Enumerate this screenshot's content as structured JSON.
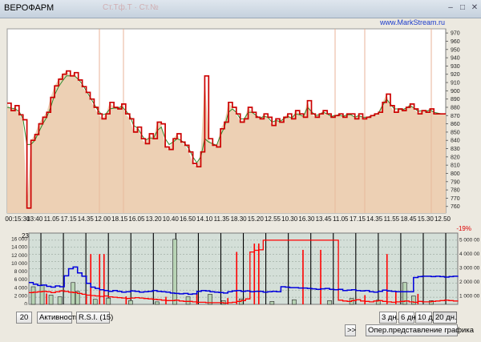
{
  "window": {
    "title": "ВЕРОФАРМ",
    "faint_title": "Ст.Тф.Т · Ст.№",
    "minimize_glyph": "–",
    "maximize_glyph": "□",
    "close_glyph": "✕"
  },
  "watermark": "www.MarkStream.ru",
  "price_panel": {
    "y_ticks": [
      970,
      960,
      950,
      940,
      930,
      920,
      910,
      900,
      890,
      880,
      870,
      860,
      850,
      840,
      830,
      820,
      810,
      800,
      790,
      780,
      770,
      760
    ],
    "ylim": [
      752,
      975
    ],
    "x_time_labels": [
      "00:15:30",
      "13:40",
      "11.05",
      "17.15",
      "14.35",
      "12.00",
      "18.15",
      "16.05",
      "13.20",
      "10.40",
      "16.50",
      "14.10",
      "11.35",
      "18.30",
      "15.20",
      "12.55",
      "10.30",
      "16.30",
      "13.45",
      "11.05",
      "17.15",
      "14.35",
      "11.55",
      "18.45",
      "15.30",
      "12.50"
    ],
    "price_line": [
      885,
      876,
      882,
      871,
      865,
      758,
      840,
      847,
      860,
      868,
      874,
      892,
      906,
      914,
      920,
      924,
      918,
      922,
      913,
      905,
      898,
      890,
      880,
      872,
      866,
      872,
      886,
      880,
      878,
      884,
      872,
      866,
      850,
      856,
      842,
      836,
      848,
      842,
      862,
      860,
      832,
      829,
      842,
      848,
      838,
      834,
      826,
      812,
      808,
      826,
      918,
      842,
      834,
      832,
      854,
      862,
      886,
      880,
      872,
      862,
      866,
      880,
      874,
      868,
      866,
      872,
      868,
      858,
      866,
      862,
      868,
      872,
      866,
      876,
      872,
      868,
      888,
      872,
      868,
      872,
      876,
      872,
      868,
      870,
      872,
      868,
      872,
      872,
      866,
      872,
      866,
      868,
      870,
      872,
      874,
      886,
      896,
      882,
      874,
      878,
      876,
      880,
      884,
      878,
      872,
      876,
      874,
      878,
      872,
      872,
      872,
      872
    ],
    "avg_line": [
      880,
      879,
      878,
      875,
      866,
      835,
      835,
      840,
      850,
      860,
      868,
      880,
      895,
      905,
      912,
      918,
      918,
      918,
      914,
      908,
      900,
      892,
      884,
      876,
      871,
      872,
      878,
      879,
      879,
      881,
      876,
      870,
      858,
      855,
      847,
      840,
      843,
      842,
      852,
      856,
      842,
      835,
      838,
      842,
      840,
      836,
      830,
      820,
      813,
      820,
      842,
      838,
      836,
      834,
      846,
      856,
      874,
      878,
      874,
      866,
      866,
      874,
      874,
      870,
      867,
      869,
      868,
      862,
      864,
      863,
      866,
      869,
      867,
      872,
      871,
      869,
      880,
      875,
      870,
      871,
      874,
      872,
      869,
      870,
      871,
      869,
      871,
      871,
      868,
      870,
      868,
      868,
      869,
      871,
      873,
      882,
      890,
      884,
      878,
      878,
      877,
      879,
      882,
      879,
      875,
      876,
      875,
      877,
      874,
      873,
      872,
      872
    ]
  },
  "volume_panel": {
    "date_labels": [
      "23.09",
      "26.09",
      "27.09",
      "28.09",
      "29.09",
      "30.09",
      "03.10",
      "04.10",
      "05.10",
      "06.10",
      "07.10",
      "10.10",
      "11.10",
      "12.10",
      "13.10",
      "14.10",
      "17.10",
      "18.10",
      "19.10"
    ],
    "pct_label": "-19%",
    "left_ticks": [
      "16 000",
      "14 000",
      "12 000",
      "10 000",
      "8 000",
      "6 000",
      "4 000",
      "2 000",
      "0"
    ],
    "right_ticks": [
      "5 000 00",
      "4 000 00",
      "3 000 00",
      "2 000 00",
      "1 000 00"
    ],
    "ylim": [
      0,
      17000
    ],
    "blue_series": [
      5200,
      4800,
      4500,
      4600,
      4300,
      4100,
      4400,
      4200,
      6800,
      8500,
      8900,
      7500,
      6700,
      5000,
      4100,
      3800,
      3500,
      3300,
      3100,
      3300,
      3100,
      2900,
      3000,
      3200,
      3100,
      2900,
      3000,
      3100,
      3300,
      3100,
      3000,
      2900,
      2700,
      2600,
      2500,
      2600,
      2400,
      2500,
      3100,
      3300,
      3200,
      3000,
      2900,
      2800,
      2700,
      3000,
      3200,
      3300,
      3100,
      3200,
      3000,
      3100,
      3100,
      2900,
      3000,
      3100,
      3000,
      4200,
      4100,
      4000,
      4000,
      3900,
      3900,
      3800,
      3700,
      3600,
      3700,
      3800,
      3600,
      3500,
      3600,
      3300,
      3400,
      3500,
      3300,
      3200,
      3300,
      3000,
      2900,
      3100,
      3400,
      3200,
      3100,
      3000,
      3000,
      3000,
      3000,
      6400,
      6600,
      6700,
      6700,
      6600,
      6700,
      6600,
      6500,
      6600,
      6700,
      6800
    ],
    "red_series": [
      2800,
      2900,
      3000,
      3100,
      3000,
      2800,
      3000,
      3200,
      3100,
      2900,
      2800,
      2600,
      2400,
      2200,
      2100,
      2000,
      1900,
      2000,
      1800,
      1700,
      1600,
      1500,
      1400,
      1500,
      1600,
      1500,
      1400,
      1300,
      1200,
      1100,
      1000,
      900,
      900,
      1000,
      800,
      700,
      700,
      600,
      500,
      500,
      400,
      400,
      400,
      400,
      300,
      400,
      500,
      700,
      900,
      1300,
      12500,
      12900,
      13000,
      15300,
      15300,
      15300,
      15300,
      15300,
      15300,
      15300,
      15300,
      15300,
      15300,
      15300,
      15300,
      15300,
      15300,
      15300,
      15300,
      15300,
      1000,
      800,
      700,
      900,
      1100,
      800,
      700,
      600,
      800,
      900,
      700,
      600,
      500,
      600,
      700,
      800,
      600,
      500,
      700,
      600,
      600,
      700,
      800,
      900,
      1000,
      900,
      800,
      900
    ],
    "red_spikes": [
      {
        "idx": 4,
        "value": 2600
      },
      {
        "idx": 13,
        "value": 2000
      },
      {
        "idx": 14,
        "value": 12000
      },
      {
        "idx": 16,
        "value": 12000
      },
      {
        "idx": 17,
        "value": 12000
      },
      {
        "idx": 22,
        "value": 1900
      },
      {
        "idx": 31,
        "value": 1800
      },
      {
        "idx": 38,
        "value": 2600
      },
      {
        "idx": 45,
        "value": 1500
      },
      {
        "idx": 47,
        "value": 12500
      },
      {
        "idx": 51,
        "value": 14500
      },
      {
        "idx": 52,
        "value": 14500
      },
      {
        "idx": 62,
        "value": 13000
      },
      {
        "idx": 66,
        "value": 13000
      },
      {
        "idx": 76,
        "value": 2200
      },
      {
        "idx": 81,
        "value": 12000
      },
      {
        "idx": 83,
        "value": 3200
      },
      {
        "idx": 88,
        "value": 2500
      }
    ],
    "volume_bars": [
      {
        "idx": 1,
        "value": 4200
      },
      {
        "idx": 3,
        "value": 4600
      },
      {
        "idx": 5,
        "value": 2200
      },
      {
        "idx": 7,
        "value": 1800
      },
      {
        "idx": 10,
        "value": 5200
      },
      {
        "idx": 11,
        "value": 3100
      },
      {
        "idx": 15,
        "value": 1200
      },
      {
        "idx": 18,
        "value": 1500
      },
      {
        "idx": 23,
        "value": 900
      },
      {
        "idx": 29,
        "value": 600
      },
      {
        "idx": 33,
        "value": 15500
      },
      {
        "idx": 36,
        "value": 1800
      },
      {
        "idx": 41,
        "value": 2400
      },
      {
        "idx": 44,
        "value": 900
      },
      {
        "idx": 48,
        "value": 1300
      },
      {
        "idx": 55,
        "value": 700
      },
      {
        "idx": 60,
        "value": 1100
      },
      {
        "idx": 68,
        "value": 900
      },
      {
        "idx": 73,
        "value": 1400
      },
      {
        "idx": 79,
        "value": 1000
      },
      {
        "idx": 85,
        "value": 5200
      },
      {
        "idx": 87,
        "value": 2000
      },
      {
        "idx": 91,
        "value": 900
      }
    ]
  },
  "controls": {
    "period_value": "20",
    "activity_label": "Активность",
    "rsi_label": "R.S.I.",
    "rsi_value": "(15)",
    "scroll_label": ">>",
    "range_buttons": [
      "3 дн.",
      "6 дн.",
      "10 дн.",
      "20 дн."
    ],
    "active_range": "20 дн.",
    "oper_view_label": "Опер.представление графика"
  },
  "colors": {
    "price_fill": "#edd0b4",
    "price_line": "#cc0000",
    "avg_line": "#2e8b2e",
    "vol_panel_bg": "#d4dfd8",
    "blue_line": "#0000dd",
    "red_line": "#ff0000",
    "vol_bar_fill": "#b7d3b4",
    "day_separator": "#000000"
  }
}
